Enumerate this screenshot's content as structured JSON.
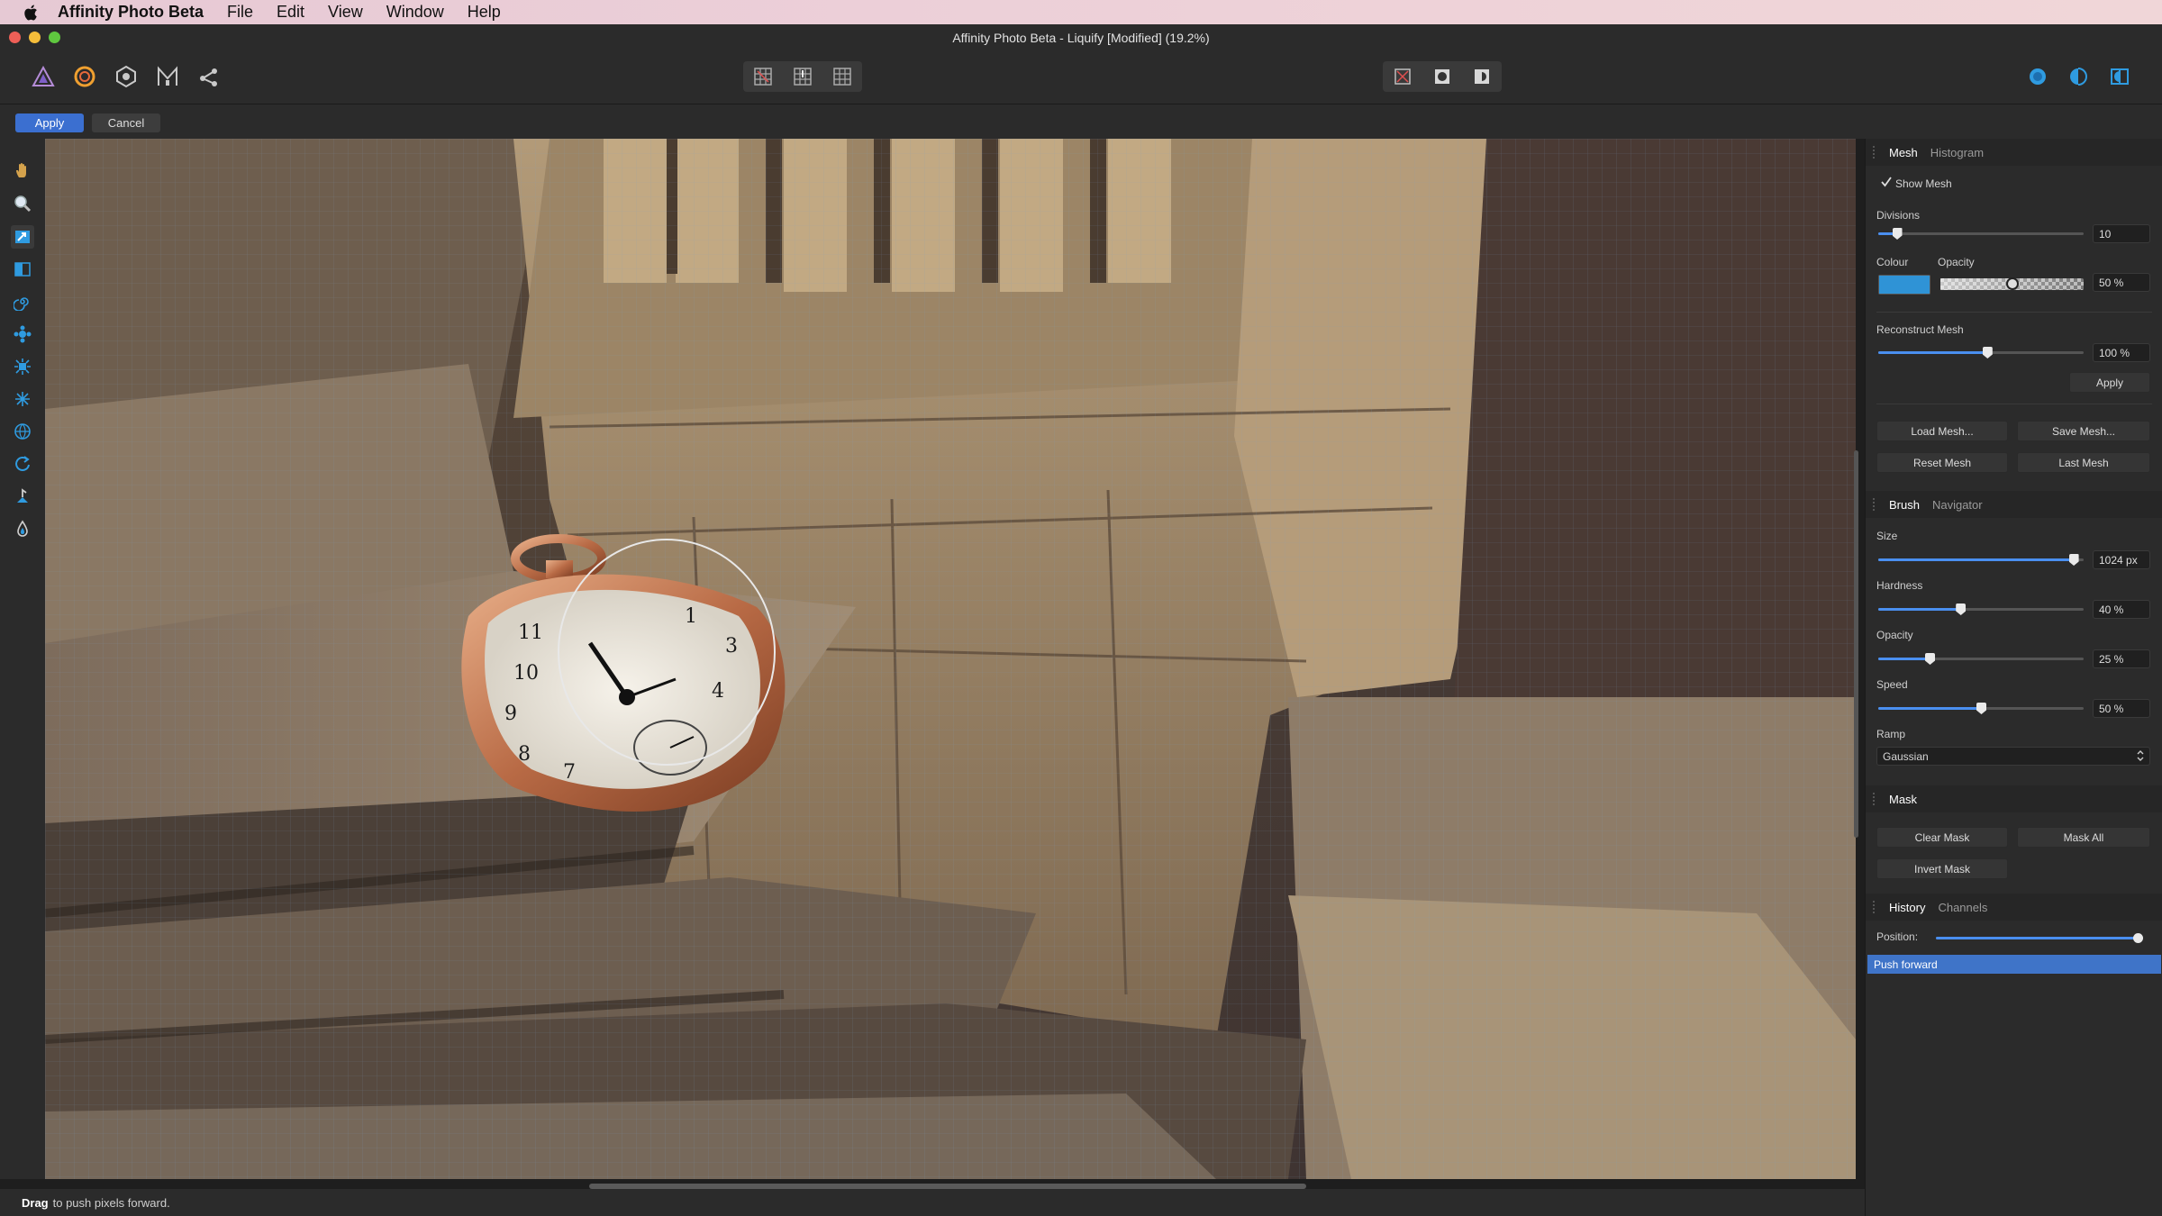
{
  "menubar": {
    "app_name": "Affinity Photo Beta",
    "items": [
      "File",
      "Edit",
      "View",
      "Window",
      "Help"
    ]
  },
  "window": {
    "title": "Affinity Photo Beta - Liquify [Modified] (19.2%)"
  },
  "context": {
    "apply_label": "Apply",
    "cancel_label": "Cancel"
  },
  "status": {
    "action": "Drag",
    "hint": "to push pixels forward."
  },
  "mesh_panel": {
    "tabs": [
      "Mesh",
      "Histogram"
    ],
    "show_mesh_label": "Show Mesh",
    "show_mesh_checked": true,
    "divisions_label": "Divisions",
    "divisions_value": "10",
    "divisions_level": 0.09,
    "colour_label": "Colour",
    "colour_value": "#2f93d6",
    "opacity_label": "Opacity",
    "opacity_value": "50 %",
    "opacity_level": 0.5,
    "reconstruct_label": "Reconstruct Mesh",
    "reconstruct_value": "100 %",
    "reconstruct_level": 0.53,
    "apply_label": "Apply",
    "load_label": "Load Mesh...",
    "save_label": "Save Mesh...",
    "reset_label": "Reset Mesh",
    "last_label": "Last Mesh"
  },
  "brush_panel": {
    "tabs": [
      "Brush",
      "Navigator"
    ],
    "size_label": "Size",
    "size_value": "1024 px",
    "size_level": 0.95,
    "hardness_label": "Hardness",
    "hardness_value": "40 %",
    "hardness_level": 0.4,
    "opacity_label": "Opacity",
    "opacity_value": "25 %",
    "opacity_level": 0.25,
    "speed_label": "Speed",
    "speed_value": "50 %",
    "speed_level": 0.5,
    "ramp_label": "Ramp",
    "ramp_value": "Gaussian"
  },
  "mask_panel": {
    "tabs": [
      "Mask"
    ],
    "clear_label": "Clear Mask",
    "mask_all_label": "Mask All",
    "invert_label": "Invert Mask"
  },
  "history_panel": {
    "tabs": [
      "History",
      "Channels"
    ],
    "position_label": "Position:",
    "position_level": 1.0,
    "items": [
      "Push forward"
    ]
  },
  "colors": {
    "accent": "#3b6fd0",
    "panel_bg": "#2b2b2b",
    "selection": "#3f74c8"
  }
}
